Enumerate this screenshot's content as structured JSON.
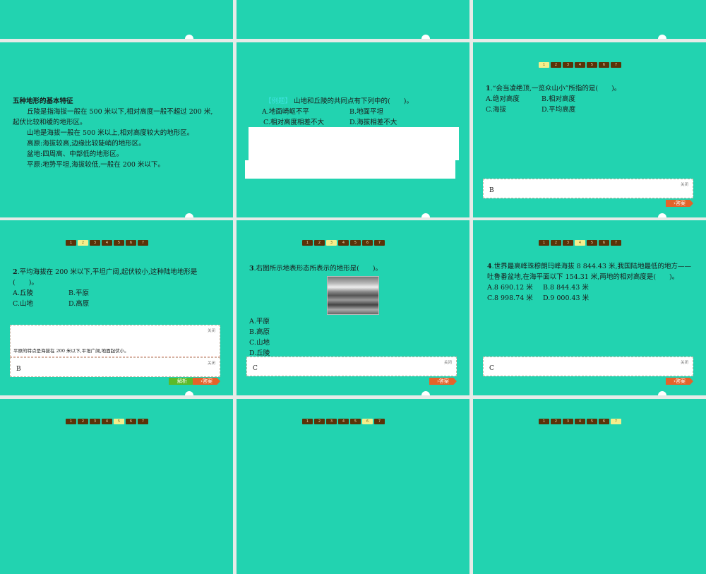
{
  "nav_pages": [
    "1",
    "2",
    "3",
    "4",
    "5",
    "6",
    "7"
  ],
  "close_label": "关闭",
  "answer_button": "答案",
  "explain_button": "解析",
  "s1": {
    "title": "五种地形的基本特征",
    "lines": [
      "丘陵是指海拔一般在 500 米以下,相对高度一般不超过 200 米,",
      "起伏比较和缓的地形区。",
      "山地是海拔一般在 500 米以上,相对高度较大的地形区。",
      "高原:海拔较高,边缘比较陡峭的地形区。",
      "盆地:四周高、中部低的地形区。",
      "平原:地势平坦,海拔较低,一般在 200 米以下。"
    ]
  },
  "s2": {
    "tag": "【例题】",
    "question": "山地和丘陵的共同点有下列中的(　　)。",
    "options": [
      "A.地面崎岖不平",
      "B.地面平坦",
      "C.相对高度相差不大",
      "D.海拔相差不大"
    ]
  },
  "q1": {
    "num": "1",
    "question": ".“会当凌绝顶,一览众山小”所指的是(　　)。",
    "options": [
      "A.绝对高度",
      "B.相对高度",
      "C.海拔",
      "D.平均高度"
    ],
    "answer": "B"
  },
  "q2": {
    "num": "2",
    "question": ".平均海拔在 200 米以下,平坦广阔,起伏较小,这种陆地地形是",
    "question2": "(　　)。",
    "options": [
      "A.丘陵",
      "B.平原",
      "C.山地",
      "D.高原"
    ],
    "explanation": "平原的特点是海拔在 200 米以下,平坦广阔,地面起伏小。",
    "answer": "B"
  },
  "q3": {
    "num": "3",
    "question": ".右图所示地表形态所表示的地形是(　　)。",
    "options": [
      "A.平原",
      "B.高原",
      "C.山地",
      "D.丘陵"
    ],
    "answer": "C"
  },
  "q4": {
    "num": "4",
    "question": ".世界最高峰珠穆朗玛峰海拔 8 844.43 米,我国陆地最低的地方——",
    "question2": "吐鲁番盆地,在海平面以下 154.31 米,两地的相对高度是(　　)。",
    "options": [
      "A.8 690.12 米",
      "B.8 844.43 米",
      "C.8 998.74 米",
      "D.9 000.43 米"
    ],
    "answer": "C"
  },
  "active_pages": {
    "q1": 1,
    "q2": 2,
    "q3": 3,
    "q4": 4,
    "r4a": 5,
    "r4b": 6,
    "r4c": 7
  }
}
